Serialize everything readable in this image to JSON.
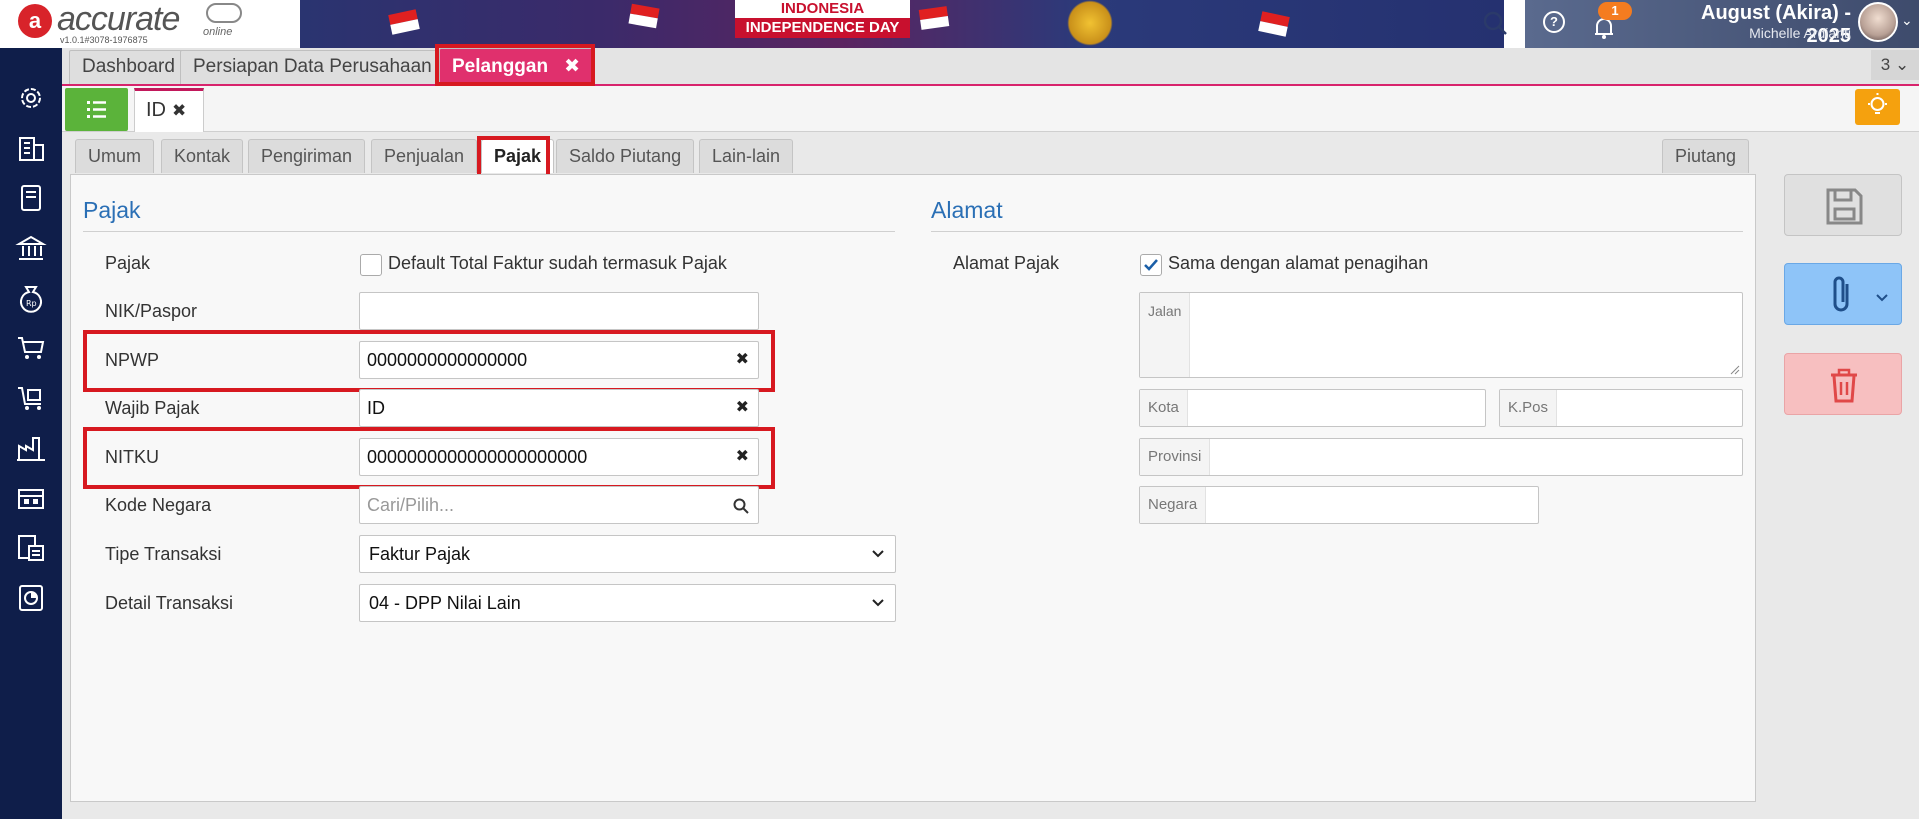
{
  "header": {
    "logo_mark": "a",
    "logo_text": "accurate",
    "logo_sub": "online",
    "version": "v1.0.1#3078-1976875",
    "banner_line1": "INDONESIA",
    "banner_line2": "INDEPENDENCE DAY",
    "help_label": "?",
    "notif_count": "1",
    "db_name": "August (Akira) - 2025",
    "user_name": "Michelle Ardianti"
  },
  "sidebar": {
    "icons": [
      "gear-icon",
      "building-icon",
      "book-icon",
      "bank-icon",
      "money-bag-icon",
      "cart-icon",
      "cart-box-icon",
      "factory-icon",
      "warehouse-icon",
      "tax-doc-icon",
      "report-chart-icon"
    ]
  },
  "top_tabs": {
    "dashboard": "Dashboard",
    "persiapan": "Persiapan Data Perusahaan",
    "pelanggan": "Pelanggan",
    "close": "✖",
    "count": "3 ⌄"
  },
  "record_tab": {
    "label": "ID",
    "close": "✖"
  },
  "subtabs": {
    "umum": "Umum",
    "kontak": "Kontak",
    "pengiriman": "Pengiriman",
    "penjualan": "Penjualan",
    "pajak": "Pajak",
    "saldo_piutang": "Saldo Piutang",
    "lain_lain": "Lain-lain",
    "piutang": "Piutang"
  },
  "pajak_section": {
    "title": "Pajak",
    "pajak_label": "Pajak",
    "pajak_checkbox_label": "Default Total Faktur sudah termasuk Pajak",
    "nik_label": "NIK/Paspor",
    "nik_value": "",
    "npwp_label": "NPWP",
    "npwp_value": "0000000000000000",
    "wajib_pajak_label": "Wajib Pajak",
    "wajib_pajak_value": "ID",
    "nitku_label": "NITKU",
    "nitku_value": "0000000000000000000000",
    "kode_negara_label": "Kode Negara",
    "kode_negara_placeholder": "Cari/Pilih...",
    "tipe_transaksi_label": "Tipe Transaksi",
    "tipe_transaksi_value": "Faktur Pajak",
    "detail_transaksi_label": "Detail Transaksi",
    "detail_transaksi_value": "04 - DPP Nilai Lain",
    "clear": "✖"
  },
  "alamat_section": {
    "title": "Alamat",
    "alamat_pajak_label": "Alamat Pajak",
    "same_as_billing_label": "Sama dengan alamat penagihan",
    "same_as_billing_checked": true,
    "jalan_label": "Jalan",
    "kota_label": "Kota",
    "kpos_label": "K.Pos",
    "provinsi_label": "Provinsi",
    "negara_label": "Negara"
  },
  "colors": {
    "sidebar": "#0f1e4a",
    "active_tab": "#e0306d",
    "section_title": "#2a6fb5",
    "highlight": "#d71920",
    "list_button": "#5bb33a",
    "bulb_button": "#f5a10e"
  }
}
